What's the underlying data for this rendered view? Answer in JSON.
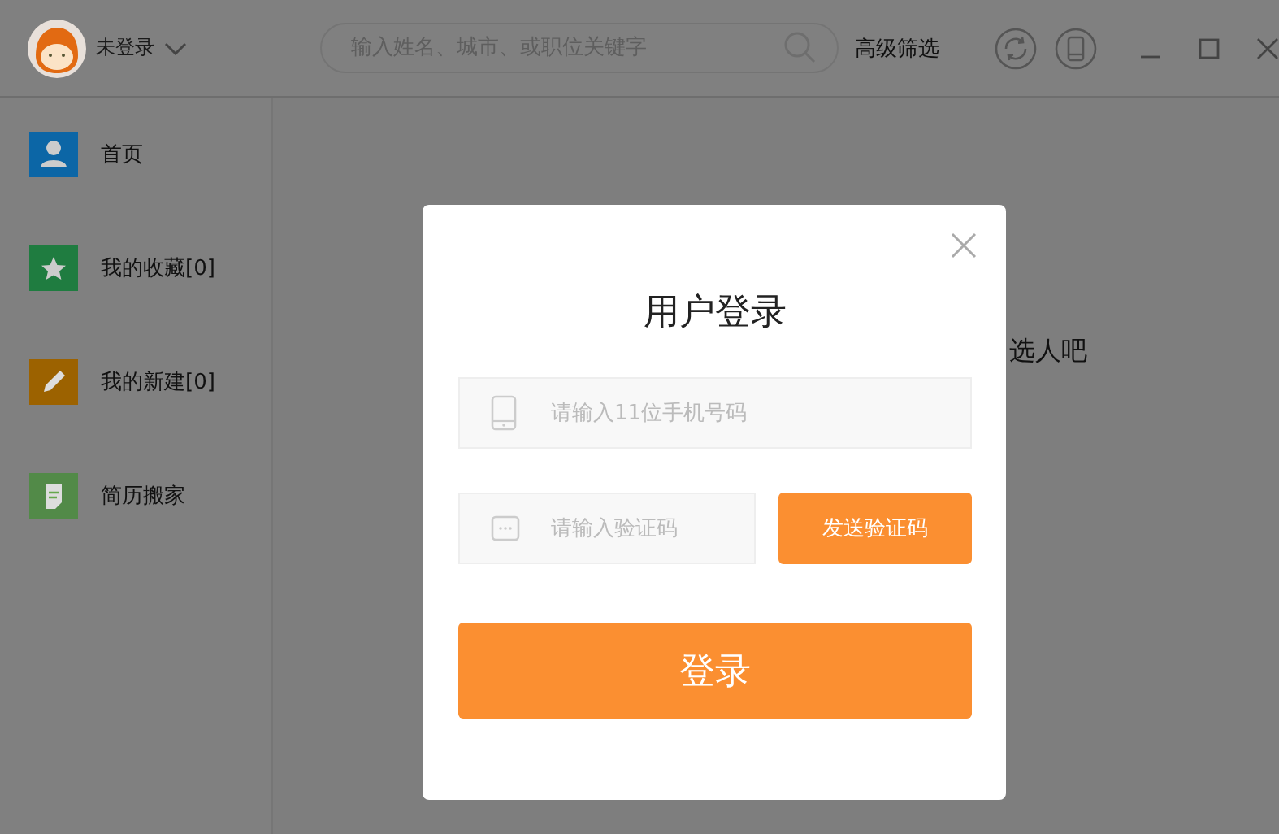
{
  "header": {
    "user": "未登录",
    "search": {
      "placeholder": "输入姓名、城市、或职位关键字"
    },
    "advanced_filter": "高级筛选"
  },
  "sidebar": {
    "items": [
      {
        "label": "首页",
        "kind": "person",
        "color": "#0c66a6"
      },
      {
        "label": "我的收藏[0]",
        "kind": "star",
        "color": "#1f7c40"
      },
      {
        "label": "我的新建[0]",
        "kind": "pencil",
        "color": "#9c6200"
      },
      {
        "label": "简历搬家",
        "kind": "doc",
        "color": "#528a48"
      }
    ]
  },
  "main": {
    "message": "选人吧"
  },
  "dialog": {
    "title": "用户登录",
    "phone": {
      "placeholder": "请输入11位手机号码"
    },
    "code": {
      "placeholder": "请输入验证码"
    },
    "send_button": "发送验证码",
    "login_button": "登录"
  }
}
